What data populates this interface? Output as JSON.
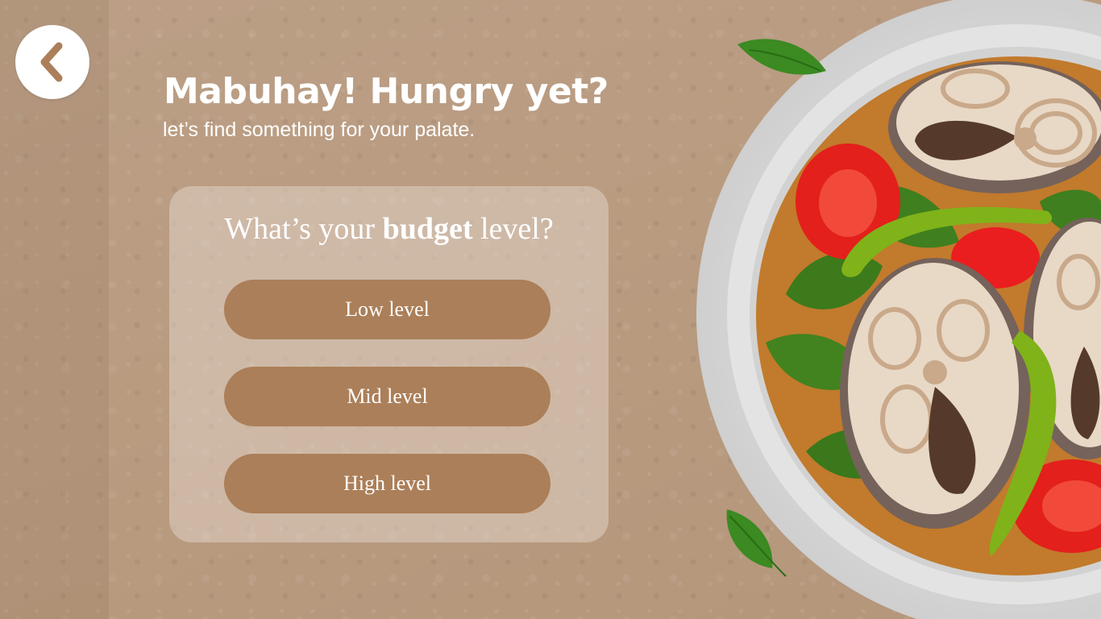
{
  "header": {
    "title": "Mabuhay! Hungry yet?",
    "subtitle": "let’s find something for your palate."
  },
  "back_button": {
    "icon": "chevron-left-icon"
  },
  "question": {
    "prefix": "What’s your",
    "emphasis": "budget",
    "suffix": "level?"
  },
  "options": [
    {
      "label": "Low level"
    },
    {
      "label": "Mid level"
    },
    {
      "label": "High level"
    }
  ],
  "colors": {
    "background": "#b99b80",
    "button": "#ab7f59",
    "card": "#e8ded4",
    "text": "#ffffff",
    "plate": "#e0e0e0",
    "soup": "#c27a2c"
  },
  "illustration": {
    "items": [
      "plate-icon",
      "fish-steak-icon",
      "tomato-icon",
      "green-chili-icon",
      "leaf-icon"
    ]
  }
}
